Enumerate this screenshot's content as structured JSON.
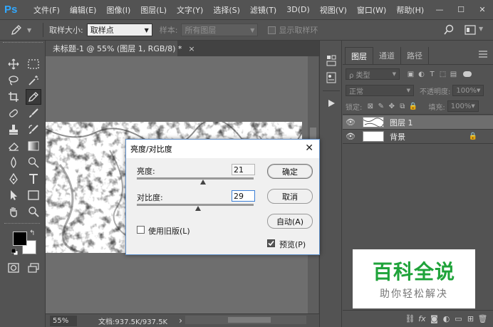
{
  "app": {
    "logo": "Ps",
    "menus": [
      "文件(F)",
      "编辑(E)",
      "图像(I)",
      "图层(L)",
      "文字(Y)",
      "选择(S)",
      "滤镜(T)",
      "3D(D)",
      "视图(V)",
      "窗口(W)",
      "帮助(H)"
    ],
    "window_controls": {
      "minimize": "—",
      "maximize": "☐",
      "close": "✕"
    }
  },
  "options_bar": {
    "sample_size_label": "取样大小:",
    "sample_size_value": "取样点",
    "sample_label": "样本:",
    "sample_value": "所有图层",
    "show_ring_label": "显示取样环"
  },
  "document": {
    "tab_title": "未标题-1 @ 55% (图层 1, RGB/8) *",
    "tab_close": "×",
    "zoom": "55%",
    "doc_size": "文档:937.5K/937.5K",
    "status_arrow": "›"
  },
  "layers_panel": {
    "tabs": [
      "图层",
      "通道",
      "路径"
    ],
    "filter_kind": "ρ 类型",
    "blend_mode": "正常",
    "opacity_label": "不透明度:",
    "opacity_value": "100%",
    "lock_label": "锁定:",
    "fill_label": "填充:",
    "fill_value": "100%",
    "layers": [
      {
        "name": "图层 1",
        "visible": true,
        "locked": false,
        "selected": true
      },
      {
        "name": "背景",
        "visible": true,
        "locked": true,
        "selected": false
      }
    ],
    "lock_icon": "🔒"
  },
  "dialog": {
    "title": "亮度/对比度",
    "close": "✕",
    "brightness_label": "亮度:",
    "brightness_value": "21",
    "brightness_level": 21,
    "contrast_label": "对比度:",
    "contrast_value": "29",
    "contrast_level": 29,
    "ok_label": "确定",
    "cancel_label": "取消",
    "auto_label": "自动(A)",
    "legacy_label": "使用旧版(L)",
    "legacy_checked": false,
    "preview_label": "预览(P)",
    "preview_checked": true
  },
  "watermark": {
    "title": "百科全说",
    "subtitle": "助你轻松解决"
  }
}
